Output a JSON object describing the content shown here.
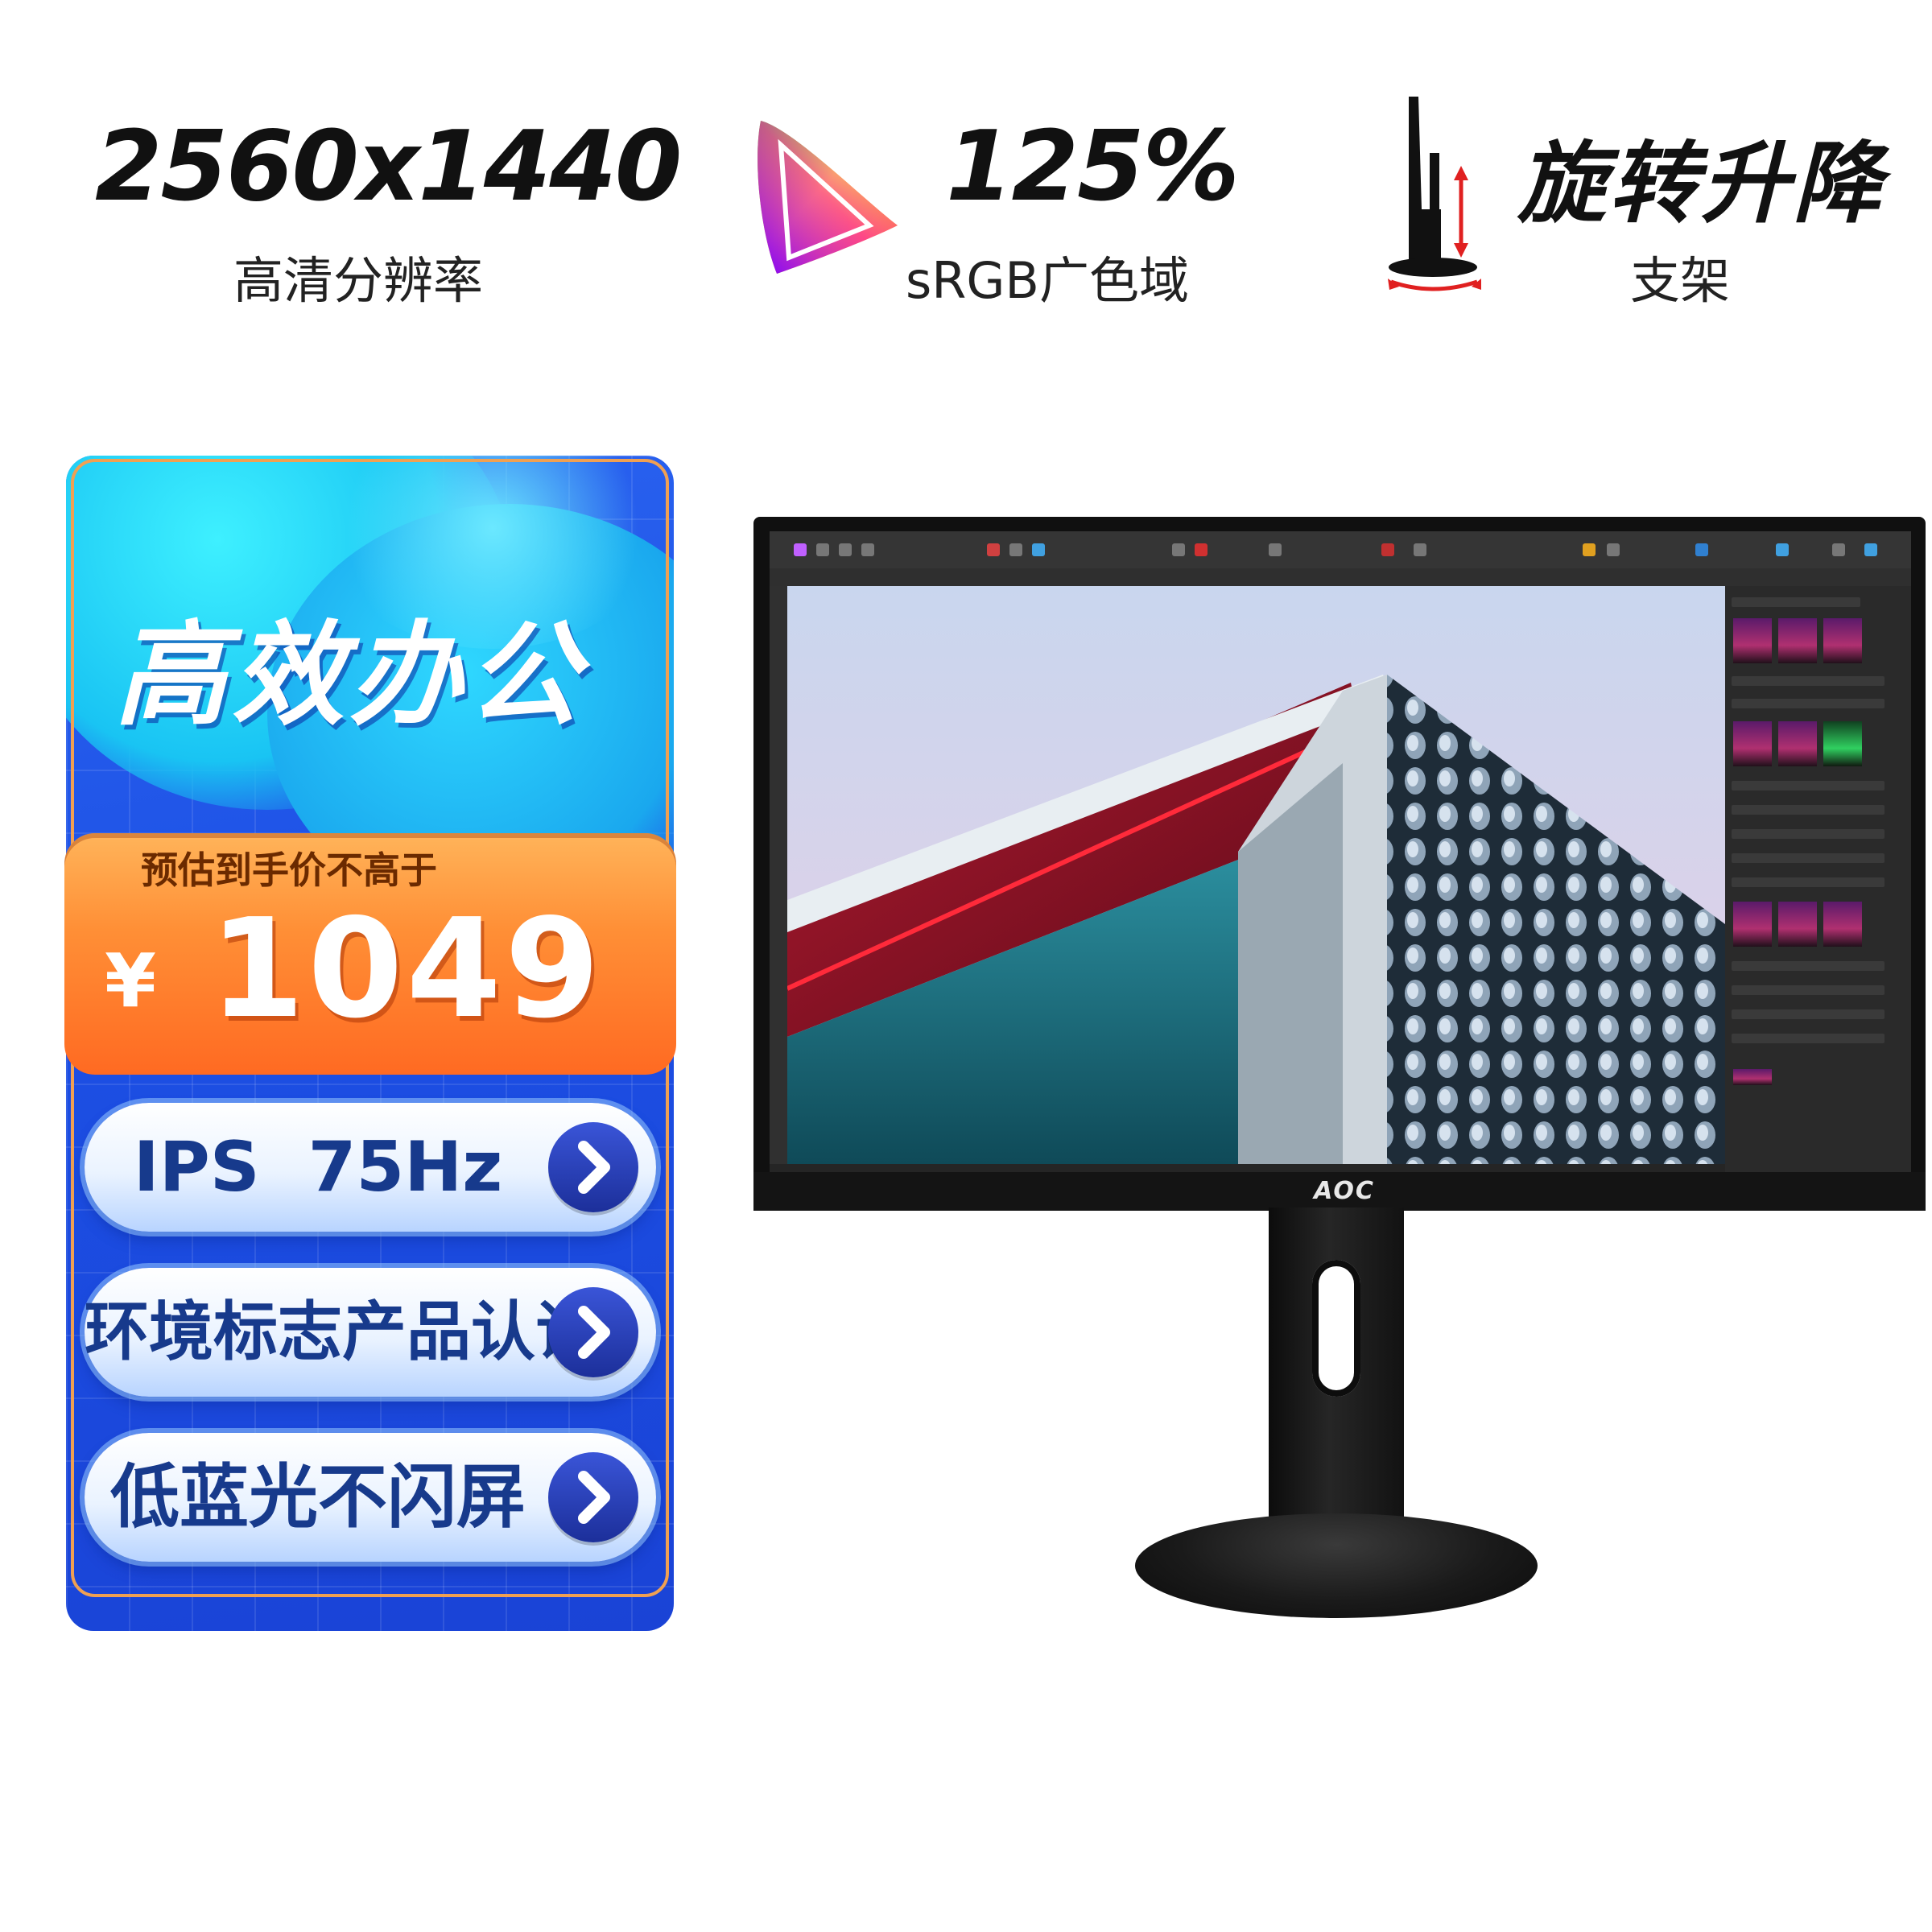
{
  "specs": [
    {
      "title": "2560x1440",
      "subtitle": "高清分辨率",
      "icon": "resolution"
    },
    {
      "title": "125%",
      "subtitle": "sRGB广色域",
      "icon": "color-gamut-icon"
    },
    {
      "title": "旋转升降",
      "subtitle": "支架",
      "icon": "stand-rotate-lift-icon"
    }
  ],
  "promo": {
    "headline": "高效办公",
    "price_label": "预估到手价不高于",
    "currency": "¥",
    "price": "1049",
    "features": [
      "IPS  75Hz",
      "环境标志产品认证",
      "低蓝光不闪屏"
    ]
  },
  "monitor": {
    "brand": "AOC"
  },
  "colors": {
    "panel_blue": "#1c4fe4",
    "price_orange": "#ff8f36",
    "pill_text": "#173a8c"
  }
}
